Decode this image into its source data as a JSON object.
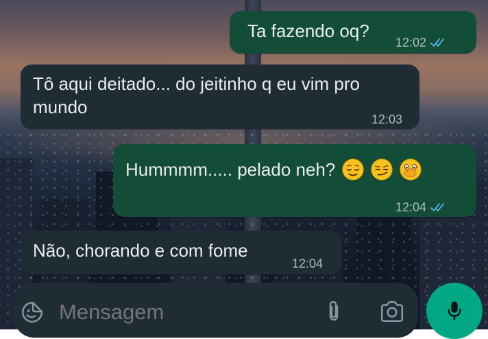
{
  "colors": {
    "bubble_outgoing": "#134d37",
    "bubble_incoming": "#1f2c34",
    "text": "#e9edef",
    "meta_text": "#aebac1",
    "read_ticks": "#53bdeb",
    "mic_button": "#00a884"
  },
  "messages": [
    {
      "direction": "outgoing",
      "text": "Ta fazendo oq?",
      "time": "12:02",
      "status": "read"
    },
    {
      "direction": "incoming",
      "line1": "Tô aqui deitado... do jeitinho q eu vim pro",
      "line2": "mundo",
      "time": "12:03"
    },
    {
      "direction": "outgoing",
      "text": "Hummmm..... pelado neh?",
      "emojis": [
        "relieved-face",
        "smirking-face",
        "face-with-hand-over-mouth"
      ],
      "time": "12:04",
      "status": "read"
    },
    {
      "direction": "incoming",
      "text": "Não, chorando e com fome",
      "time": "12:04"
    }
  ],
  "composer": {
    "placeholder": "Mensagem",
    "icons": [
      "sticker-icon",
      "paperclip-icon",
      "camera-icon",
      "mic-icon"
    ]
  }
}
